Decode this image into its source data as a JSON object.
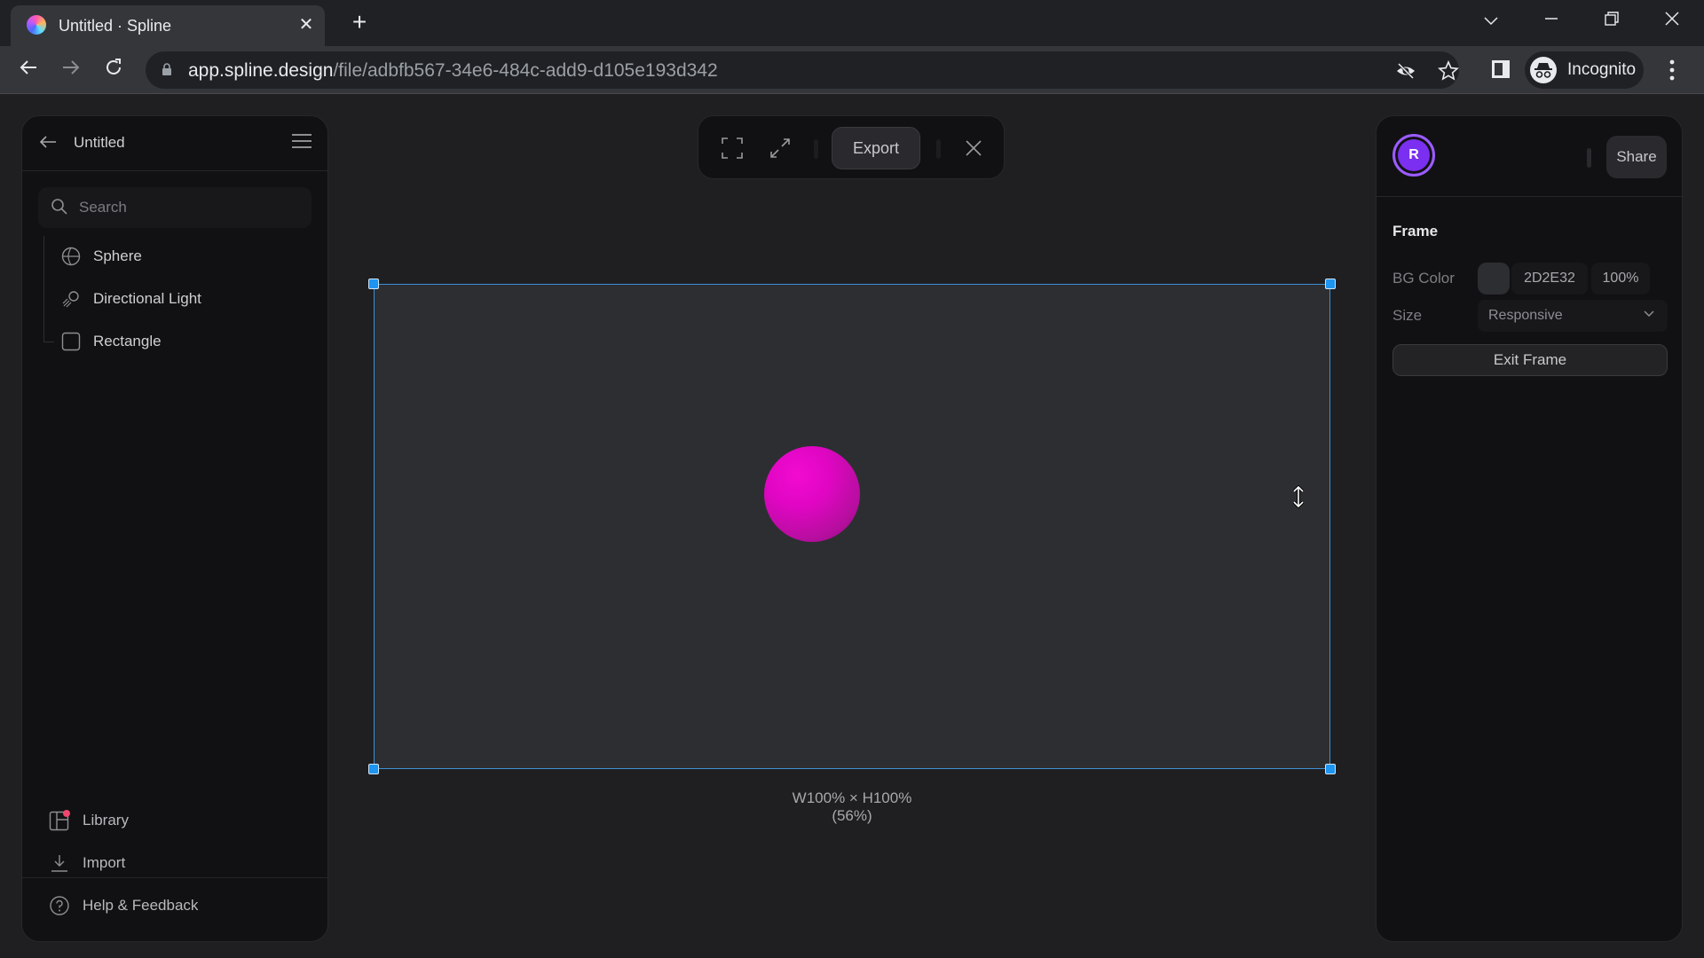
{
  "browser": {
    "tab_title": "Untitled · Spline",
    "url_host": "app.spline.design",
    "url_path": "/file/adbfb567-34e6-484c-add9-d105e193d342",
    "profile_label": "Incognito"
  },
  "left_panel": {
    "project_title": "Untitled",
    "search_placeholder": "Search",
    "objects": [
      {
        "label": "Sphere",
        "icon": "sphere-icon"
      },
      {
        "label": "Directional Light",
        "icon": "directional-light-icon"
      },
      {
        "label": "Rectangle",
        "icon": "rectangle-icon"
      }
    ],
    "footer": [
      {
        "label": "Library",
        "icon": "library-icon",
        "has_notification": true
      },
      {
        "label": "Import",
        "icon": "import-icon"
      },
      {
        "label": "Help & Feedback",
        "icon": "help-icon"
      }
    ]
  },
  "toolbar": {
    "export_label": "Export"
  },
  "canvas": {
    "frame_size_label": "W100% × H100% (56%)",
    "sphere_color": "#E00AC4",
    "selection_color": "#1E95F0"
  },
  "right_panel": {
    "avatar_initial": "R",
    "avatar_color": "#7B2FF0",
    "share_label": "Share",
    "section_title": "Frame",
    "bg_color_label": "BG Color",
    "bg_color_hex": "2D2E32",
    "bg_color_opacity": "100%",
    "size_label": "Size",
    "size_value": "Responsive",
    "exit_frame_label": "Exit Frame"
  }
}
